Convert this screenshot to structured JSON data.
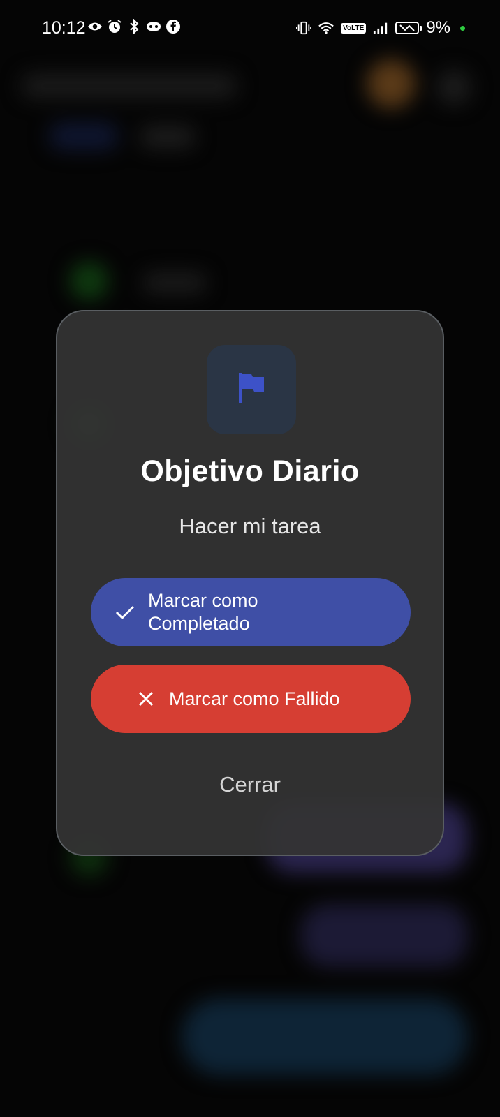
{
  "status_bar": {
    "time": "10:12",
    "battery_percent": "9%",
    "network_label": "VoLTE",
    "left_icons": [
      "eye-icon",
      "alarm-icon",
      "bluetooth-icon",
      "gamepad-icon",
      "facebook-icon"
    ],
    "right_icons": [
      "vibrate-icon",
      "wifi-icon",
      "volte-icon",
      "signal-icon",
      "battery-saver-icon"
    ]
  },
  "dialog": {
    "icon": "flag-icon",
    "title": "Objetivo Diario",
    "subtitle": "Hacer mi tarea",
    "complete_button": {
      "label": "Marcar como Completado",
      "icon": "check-icon",
      "color": "#3f4fa6"
    },
    "fail_button": {
      "label": "Marcar como Fallido",
      "icon": "close-icon",
      "color": "#d63e33"
    },
    "close_label": "Cerrar"
  },
  "colors": {
    "accent_flag": "#3d52c8",
    "dialog_bg": "#343434",
    "status_dot": "#2ecc40"
  }
}
